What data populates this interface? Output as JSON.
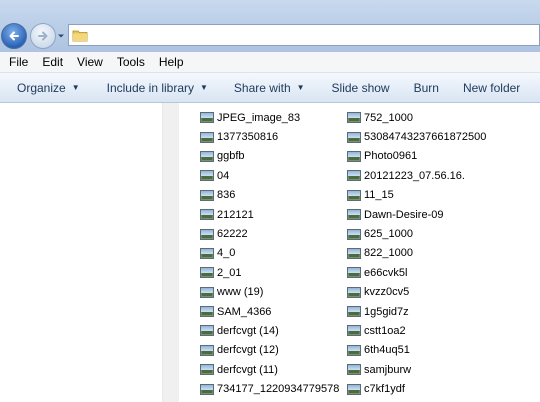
{
  "menu": [
    "File",
    "Edit",
    "View",
    "Tools",
    "Help"
  ],
  "commands": [
    {
      "label": "Organize",
      "dropdown": true
    },
    {
      "label": "Include in library",
      "dropdown": true
    },
    {
      "label": "Share with",
      "dropdown": true
    },
    {
      "label": "Slide show",
      "dropdown": false
    },
    {
      "label": "Burn",
      "dropdown": false
    },
    {
      "label": "New folder",
      "dropdown": false
    }
  ],
  "files": {
    "column1": [
      "JPEG_image_83",
      "1377350816",
      "ggbfb",
      "04",
      "836",
      "212121",
      "62222",
      "4_0",
      "2_01",
      "www (19)",
      "SAM_4366",
      "derfcvgt (14)",
      "derfcvgt (12)",
      "derfcvgt (11)",
      "734177_1220934779578"
    ],
    "column2": [
      "752_1000",
      "53084743237661872500",
      "Photo0961",
      "20121223_07.56.16.",
      "11_15",
      "Dawn-Desire-09",
      "625_1000",
      "822_1000",
      "e66cvk5l",
      "kvzz0cv5",
      "1g5gid7z",
      "cstt1oa2",
      "6th4uq51",
      "samjburw",
      "c7kf1ydf"
    ]
  },
  "icons": {
    "back": "back-arrow-icon",
    "forward": "forward-arrow-icon",
    "folder": "folder-icon",
    "file": "image-file-icon"
  },
  "colors": {
    "titlebar": "#b9cde7",
    "command_text": "#1e395b",
    "back_button": "#2b62b8"
  }
}
